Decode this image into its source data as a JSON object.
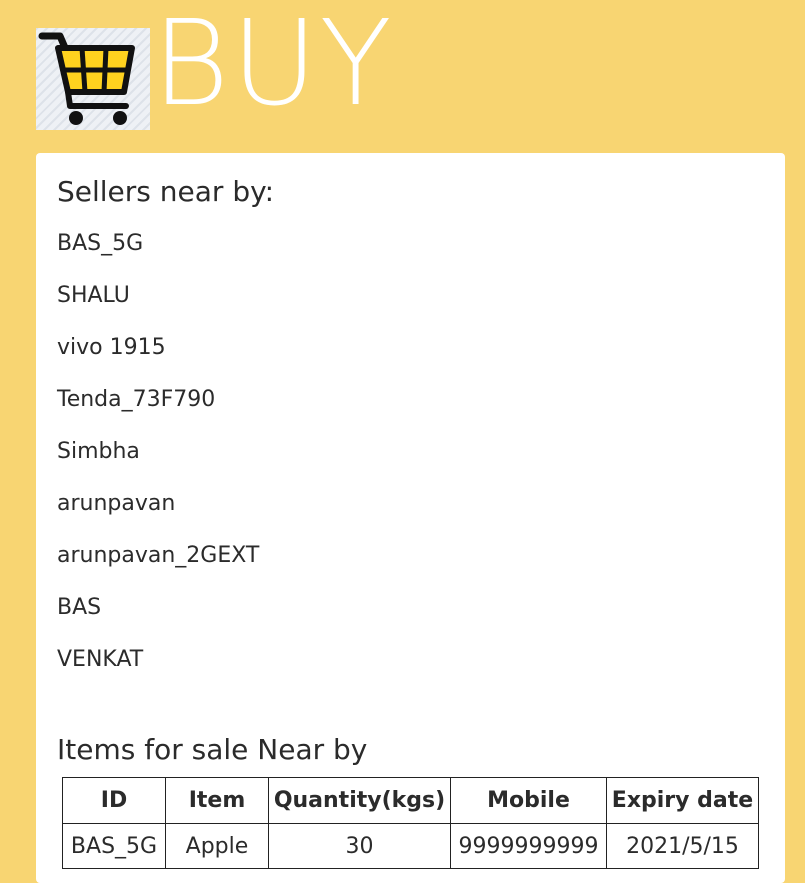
{
  "header": {
    "title": "BUY",
    "logo_icon": "shopping-cart-icon",
    "colors": {
      "background": "#f8d572",
      "cart_fill": "#ffd21f",
      "cart_stroke": "#111111"
    }
  },
  "sellers": {
    "heading": "Sellers near by:",
    "items": [
      "BAS_5G",
      "SHALU",
      "vivo 1915",
      "Tenda_73F790",
      "Simbha",
      "arunpavan",
      "arunpavan_2GEXT",
      "BAS",
      "VENKAT"
    ]
  },
  "items_for_sale": {
    "heading": "Items for sale Near by",
    "columns": [
      "ID",
      "Item",
      "Quantity(kgs)",
      "Mobile",
      "Expiry date"
    ],
    "rows": [
      [
        "BAS_5G",
        "Apple",
        "30",
        "9999999999",
        "2021/5/15"
      ]
    ]
  }
}
